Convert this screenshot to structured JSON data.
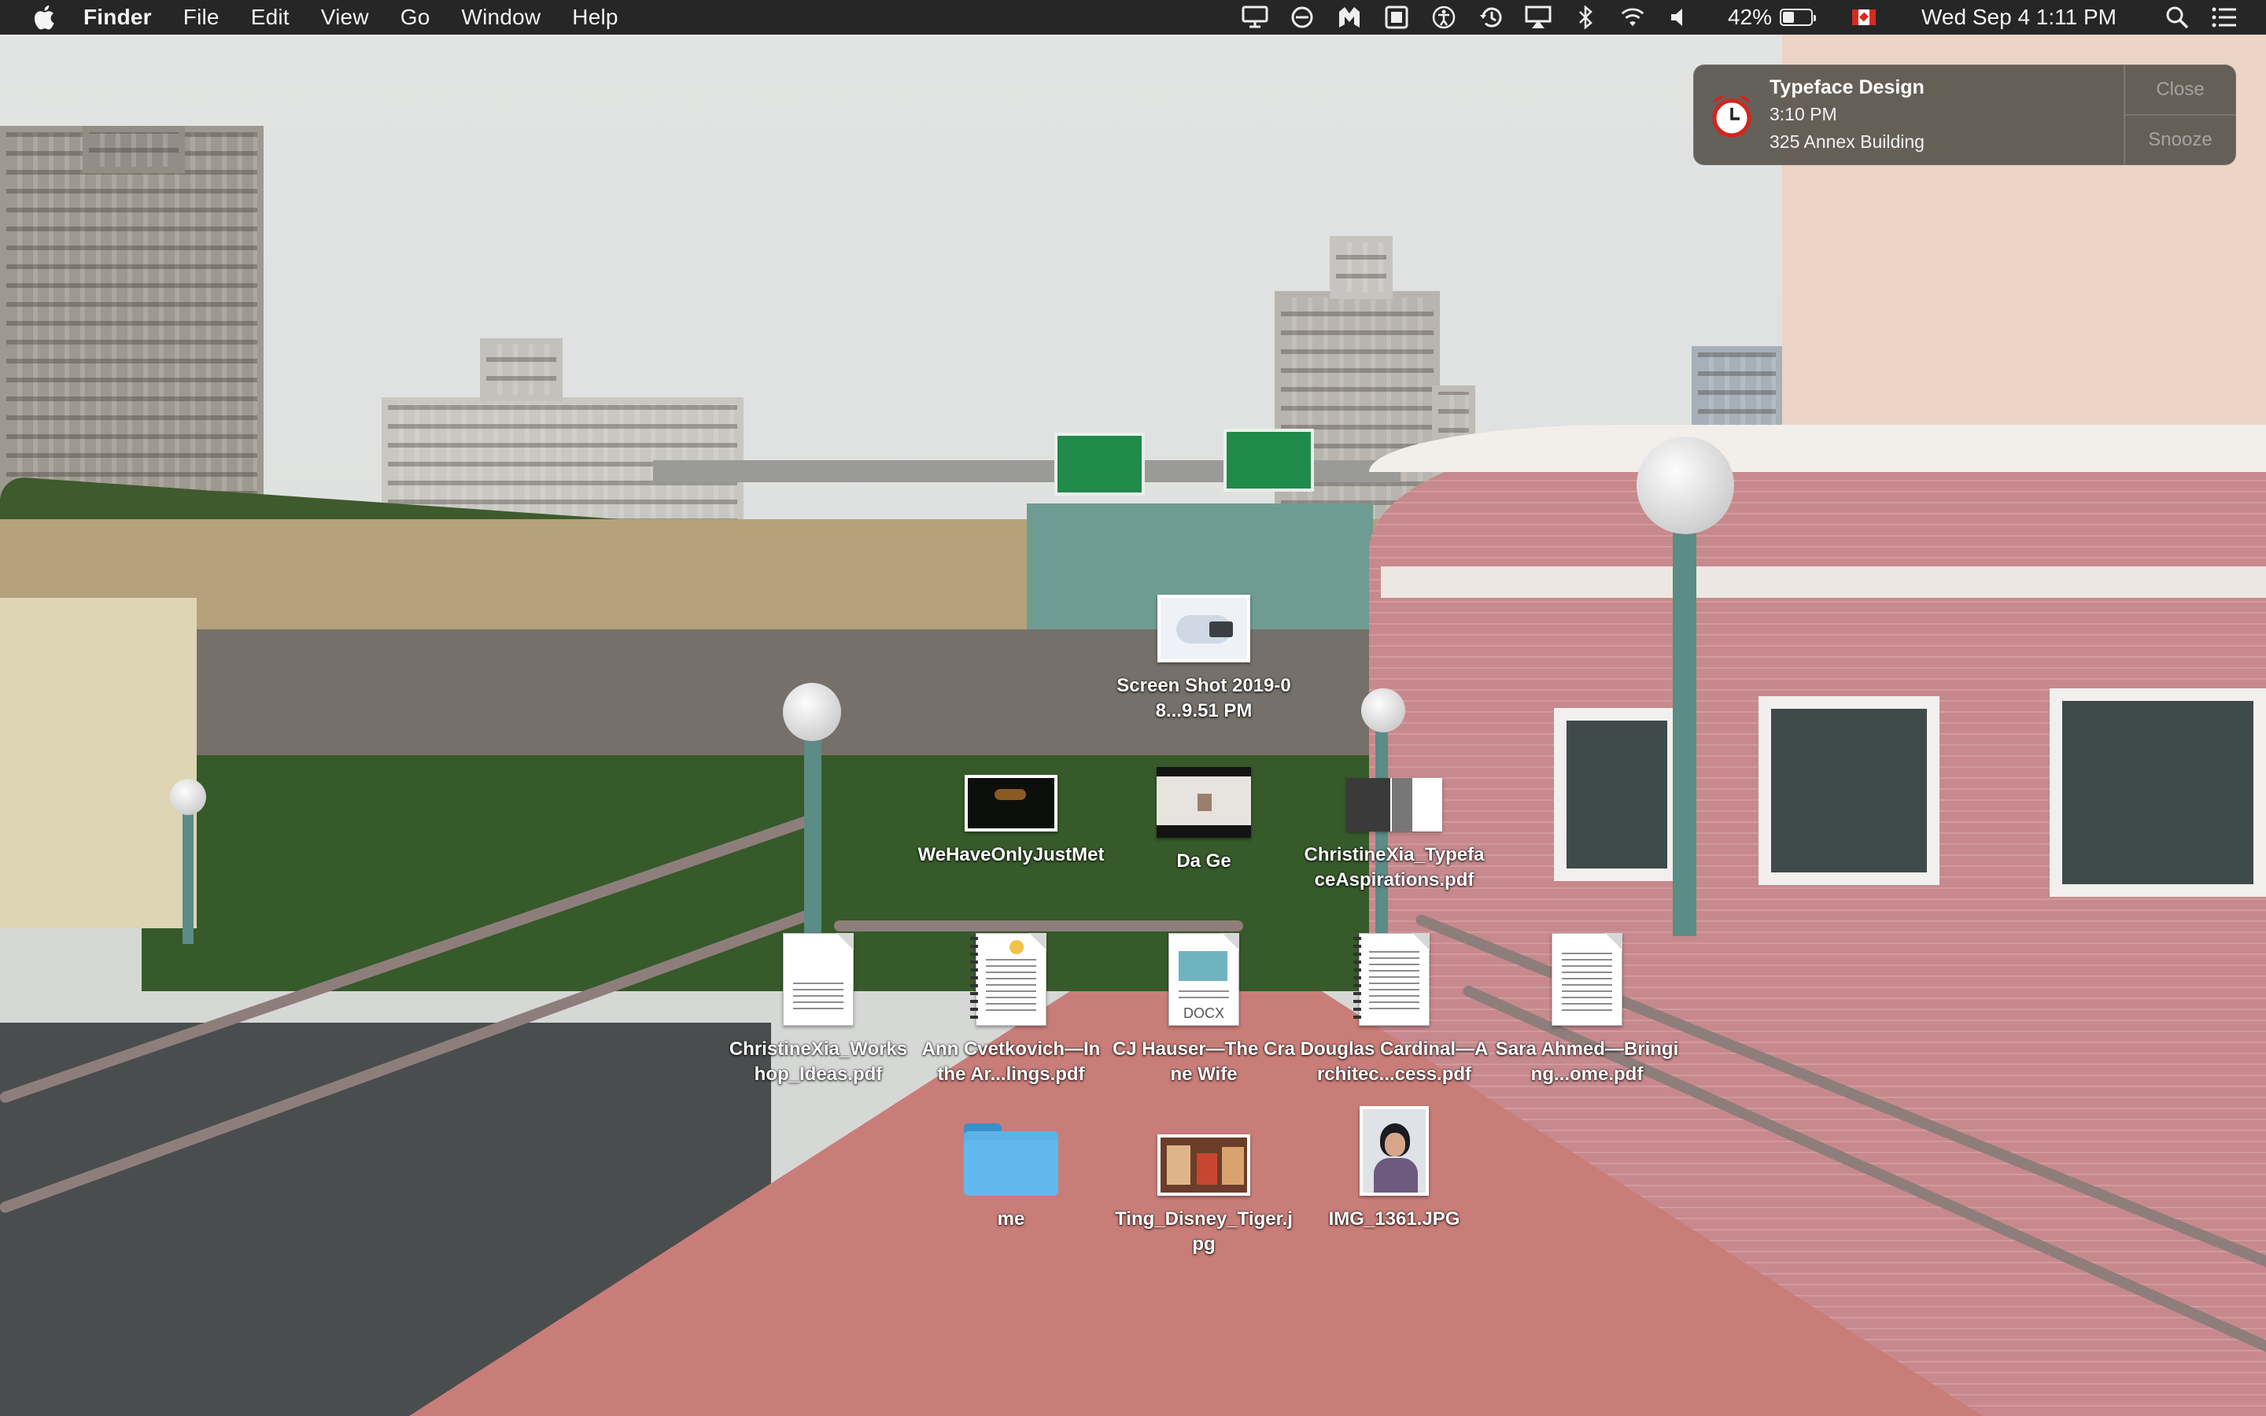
{
  "menubar": {
    "app_name": "Finder",
    "menus": [
      "File",
      "Edit",
      "View",
      "Go",
      "Window",
      "Help"
    ],
    "status_icons": [
      "display-icon",
      "sync-icon",
      "malwarebytes-icon",
      "screen-recorder-icon",
      "accessibility-icon",
      "time-machine-icon",
      "airplay-icon",
      "bluetooth-icon",
      "wifi-icon",
      "volume-icon"
    ],
    "battery_percent": "42%",
    "battery_level": 0.42,
    "input_flag": "canada-flag-icon",
    "clock": "Wed Sep 4  1:11 PM"
  },
  "notification": {
    "icon": "alarm-clock-icon",
    "title": "Typeface Design",
    "time": "3:10 PM",
    "location": "325 Annex Building",
    "close_label": "Close",
    "snooze_label": "Snooze"
  },
  "desktop": {
    "items": [
      {
        "label": "Screen Shot 2019-08...9.51 PM",
        "kind": "screenshot"
      },
      {
        "label": "WeHaveOnlyJustMet",
        "kind": "video"
      },
      {
        "label": "Da Ge",
        "kind": "image"
      },
      {
        "label": "ChristineXia_TypefaceAspirations.pdf",
        "kind": "pdf"
      },
      {
        "label": "ChristineXia_Workshop_Ideas.pdf",
        "kind": "pdf"
      },
      {
        "label": "Ann Cvetkovich—In the Ar...lings.pdf",
        "kind": "pdf"
      },
      {
        "label": "CJ Hauser—The Crane Wife",
        "kind": "docx",
        "tag": "DOCX"
      },
      {
        "label": "Douglas Cardinal—Architec...cess.pdf",
        "kind": "pdf"
      },
      {
        "label": "Sara Ahmed—Bringing...ome.pdf",
        "kind": "pdf"
      },
      {
        "label": "me",
        "kind": "folder"
      },
      {
        "label": "Ting_Disney_Tiger.jpg",
        "kind": "image"
      },
      {
        "label": "IMG_1361.JPG",
        "kind": "image"
      }
    ]
  },
  "colors": {
    "menubar_bg": "#262626",
    "notification_bg": "#5a5650",
    "folder_blue": "#5cb2e6"
  }
}
